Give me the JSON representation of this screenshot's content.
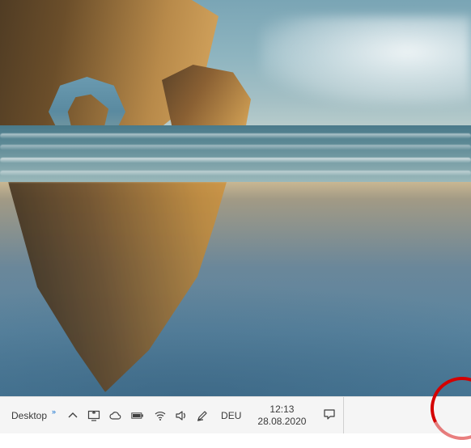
{
  "taskbar": {
    "toolbar_label": "Desktop",
    "overflow_marker": "»",
    "language": "DEU",
    "clock": {
      "time": "12:13",
      "date": "28.08.2020"
    },
    "icons": {
      "tray_overflow": "show-hidden-icons",
      "project": "project-screen",
      "onedrive": "onedrive-cloud",
      "battery": "battery",
      "wifi": "wifi",
      "volume": "volume-speaker",
      "ink": "windows-ink-pen",
      "action_center": "notification-bubble"
    }
  }
}
